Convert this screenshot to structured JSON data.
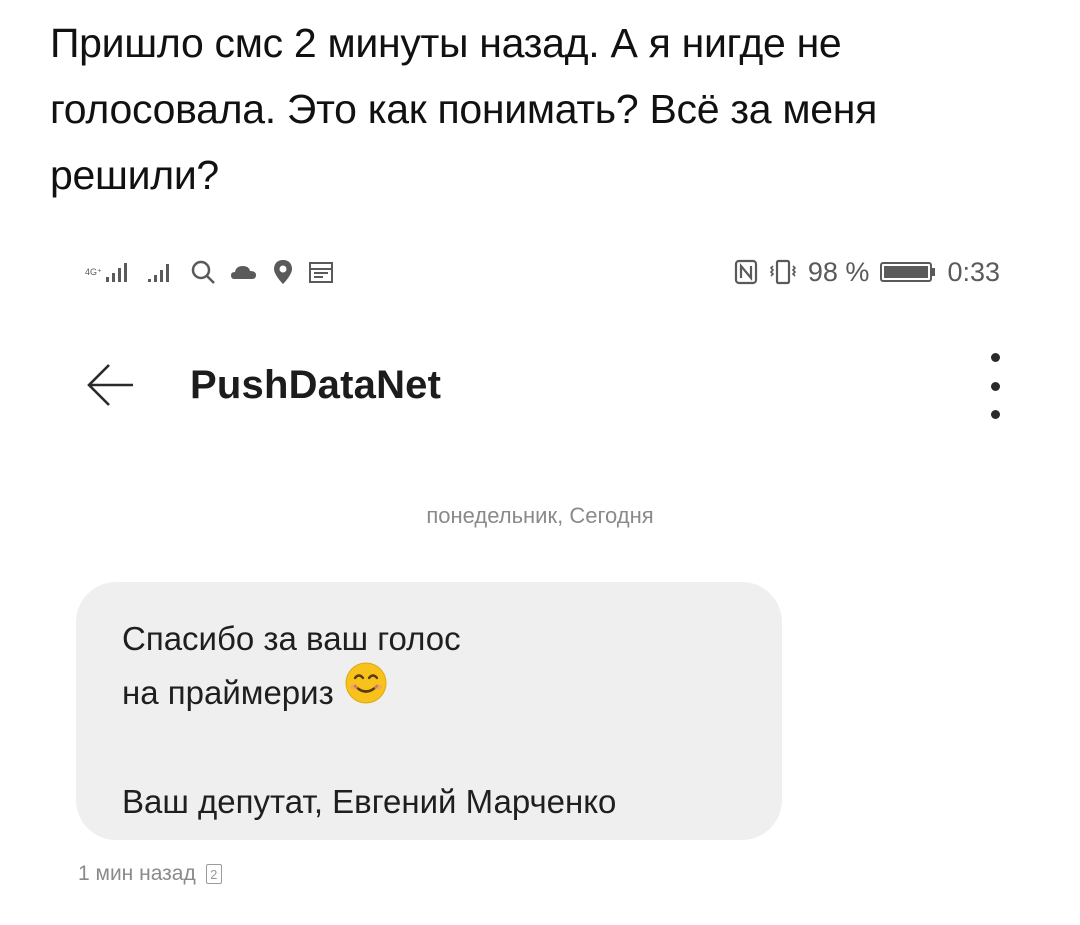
{
  "caption": {
    "line1": "Пришло смс 2 минуты назад. А я нигде не",
    "line2": "голосовала. Это как понимать? Всё за меня",
    "line3": "решили?"
  },
  "status_bar": {
    "network_label_top": "4G⁺",
    "network_label_bottom": "⁴ᴳ",
    "left_icons": [
      "signal-4g-icon",
      "signal-icon",
      "search-icon",
      "cloud-icon",
      "location-icon",
      "calendar-icon"
    ],
    "right_icons": [
      "nfc-icon",
      "vibrate-icon",
      "battery-icon"
    ],
    "battery_percent": "98 %",
    "time": "0:33"
  },
  "header": {
    "contact_name": "PushDataNet"
  },
  "conversation": {
    "date_separator": "понедельник, Сегодня",
    "message": {
      "line1": "Спасибо за ваш голос",
      "line2": "на праймериз",
      "emoji": "smiling-face-icon",
      "line3": "Ваш депутат, Евгений Марченко"
    },
    "timestamp": "1 мин назад",
    "sim_badge": "2"
  },
  "colors": {
    "bubble_background": "#efefef",
    "secondary_text": "#8a8a8a",
    "emoji_yellow": "#f7c21b"
  }
}
